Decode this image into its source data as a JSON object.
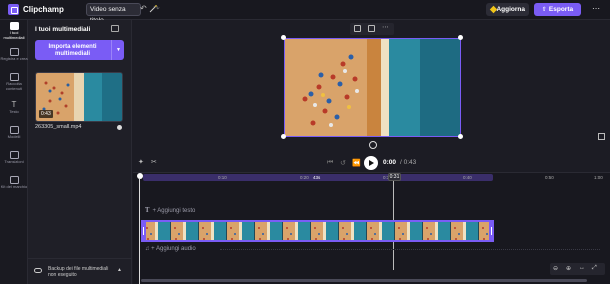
{
  "app": {
    "name": "Clipchamp",
    "project_title": "Video senza titolo"
  },
  "header": {
    "upgrade_label": "Aggiorna",
    "export_label": "Esporta",
    "more_label": "⋯"
  },
  "rail": {
    "items": [
      {
        "label": "I tuoi multimediali",
        "icon": "folder-icon",
        "active": true
      },
      {
        "label": "Registra e crea",
        "icon": "record-icon"
      },
      {
        "label": "Raccolta contenuti",
        "icon": "library-icon"
      },
      {
        "label": "Testo",
        "icon": "text-icon"
      },
      {
        "label": "Modelli",
        "icon": "templates-icon"
      },
      {
        "label": "Transizioni",
        "icon": "transitions-icon"
      },
      {
        "label": "Kit del marchio",
        "icon": "brand-kit-icon"
      }
    ]
  },
  "panel": {
    "title": "I tuoi multimediali",
    "import_label": "Importa elementi multimediali",
    "media": [
      {
        "name": "263305_small.mp4",
        "duration": "0:43"
      }
    ],
    "backup_text": "Backup dei file multimediali non eseguito"
  },
  "player": {
    "current_time": "0:00",
    "total_time": "/ 0:43"
  },
  "timeline": {
    "ticks": [
      "0:10",
      "0:20",
      "43s",
      "0:30",
      "0:40",
      "0:50",
      "1:00"
    ],
    "playhead_label": "0:31",
    "add_text_label": "+ Aggiungi testo",
    "add_audio_label": "+ Aggiungi audio",
    "text_track_icon": "T"
  },
  "colors": {
    "accent": "#7a5cf5",
    "upgrade_gem": "#f0c419"
  }
}
